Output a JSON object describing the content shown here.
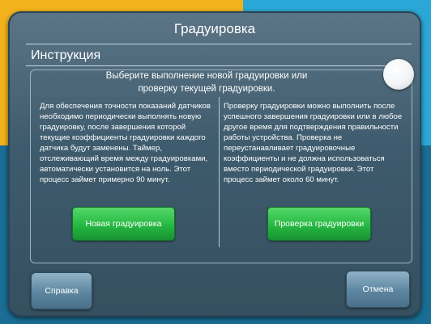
{
  "window": {
    "title": "Градуировка"
  },
  "instructions": {
    "section_title": "Инструкция",
    "prompt": "Выберите выполнение новой градуировки или проверку текущей градуировки."
  },
  "left_column": {
    "text": "Для обеспечения точности показаний датчиков необходимо периодически выполнять новую градуировку, после завершения которой текущие коэффициенты градуировки каждого датчика будут заменены. Таймер, отслеживающий время между градуировками, автоматически установится на ноль. Этот процесс займет примерно 90 минут.",
    "button_label": "Новая градуировка"
  },
  "right_column": {
    "text": "Проверку градуировки можно выполнить после успешного завершения градуировки или в любое другое время для подтверждения правильности работы устройства. Проверка не переустанавливает градуировочные коэффициенты и не должна использоваться вместо периодической градуировки. Этот процесс займет около 60 минут.",
    "button_label": "Проверка градуировки"
  },
  "footer": {
    "help_label": "Справка",
    "cancel_label": "Отмена"
  },
  "colors": {
    "accent_green": "#26b842",
    "panel_bg": "#3e5b6d",
    "button_blue": "#5d86a0"
  },
  "icons": {
    "toggle": "round-toggle-knob"
  }
}
